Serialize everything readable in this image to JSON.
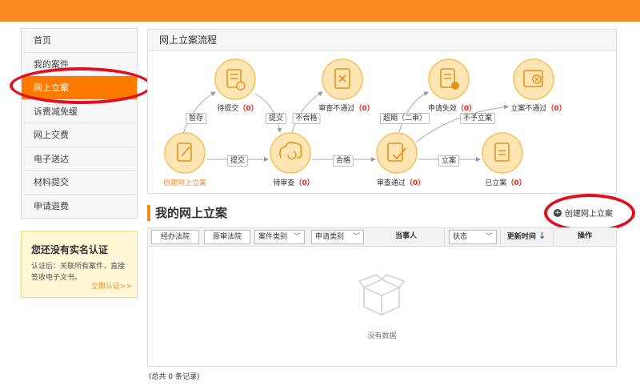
{
  "sidebar": {
    "items": [
      {
        "label": "首页"
      },
      {
        "label": "我的案件"
      },
      {
        "label": "网上立案"
      },
      {
        "label": "诉费减免缓"
      },
      {
        "label": "网上交费"
      },
      {
        "label": "电子送达"
      },
      {
        "label": "材料提交"
      },
      {
        "label": "申请退费"
      }
    ],
    "active_index": 2
  },
  "auth_box": {
    "title": "您还没有实名认证",
    "desc_line1": "认证后：关联所有案件，直接",
    "desc_line2": "签收电子文书。",
    "link": "立即认证>>"
  },
  "flow": {
    "title": "网上立案流程",
    "nodes": {
      "create": {
        "label": "创建网上立案"
      },
      "pending_submit": {
        "label": "待提交",
        "count": "（0）"
      },
      "pending_review": {
        "label": "待审查",
        "count": "（0）"
      },
      "review_failed": {
        "label": "审查不通过",
        "count": "（0）"
      },
      "review_passed": {
        "label": "审查通过",
        "count": "（0）"
      },
      "apply_invalid": {
        "label": "申请失效",
        "count": "（0）"
      },
      "not_filed": {
        "label": "立案不通过",
        "count": "（0）"
      },
      "filed": {
        "label": "已立案",
        "count": "（0）"
      }
    },
    "edges": {
      "save": "暂存",
      "submit1": "提交",
      "submit2": "提交",
      "fail": "不合格",
      "pass": "合格",
      "overdue": "超期（二审）",
      "no_file": "不予立案",
      "file": "立案"
    }
  },
  "list": {
    "title": "我的网上立案",
    "create_button": "创建网上立案",
    "columns": {
      "court": "经办法院",
      "original_court": "原审法院",
      "case_type": "案件类别",
      "apply_type": "申请类别",
      "party": "当事人",
      "status": "状态",
      "update_time": "更新时间",
      "sort_icon": "↓",
      "action": "操作"
    },
    "empty_text": "没有数据",
    "total": "(总共 0 条记录)"
  },
  "colors": {
    "accent": "#f98a22",
    "active": "#ff7b00",
    "annotation": "#e0101e",
    "count": "#e2231a"
  }
}
